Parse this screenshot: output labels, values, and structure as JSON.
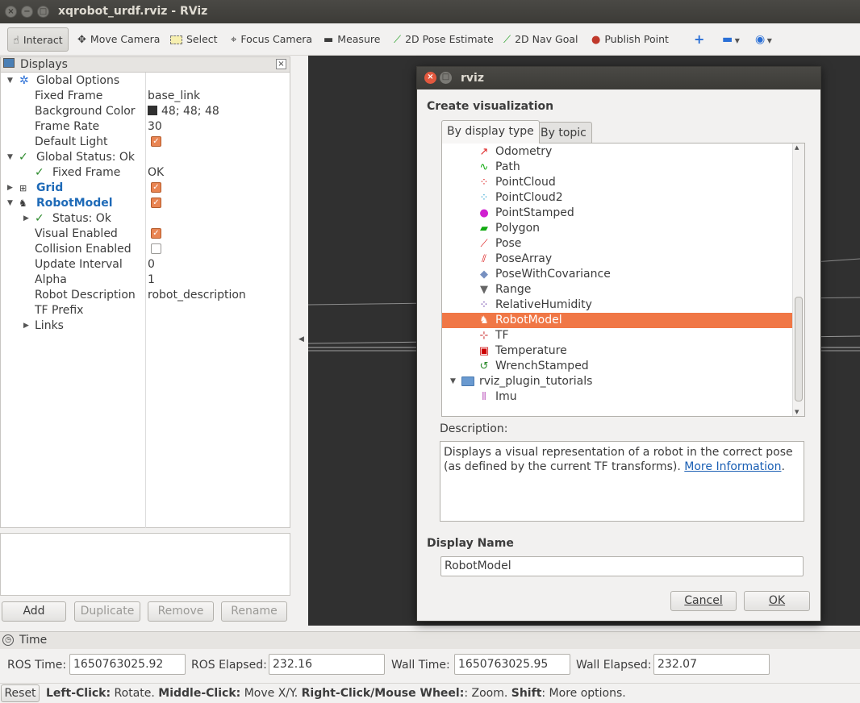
{
  "window": {
    "title": "xqrobot_urdf.rviz - RViz"
  },
  "toolbar": {
    "interact": "Interact",
    "move_camera": "Move Camera",
    "select": "Select",
    "focus_camera": "Focus Camera",
    "measure": "Measure",
    "pose_estimate": "2D Pose Estimate",
    "nav_goal": "2D Nav Goal",
    "publish_point": "Publish Point"
  },
  "displays": {
    "title": "Displays",
    "global_options": "Global Options",
    "fixed_frame_label": "Fixed Frame",
    "fixed_frame_value": "base_link",
    "bg_color_label": "Background Color",
    "bg_color_value": "48; 48; 48",
    "frame_rate_label": "Frame Rate",
    "frame_rate_value": "30",
    "default_light_label": "Default Light",
    "global_status": "Global Status: Ok",
    "gs_fixed_frame": "Fixed Frame",
    "gs_fixed_frame_value": "OK",
    "grid": "Grid",
    "robot_model": "RobotModel",
    "status_ok": "Status: Ok",
    "visual_enabled": "Visual Enabled",
    "collision_enabled": "Collision Enabled",
    "update_interval_label": "Update Interval",
    "update_interval_value": "0",
    "alpha_label": "Alpha",
    "alpha_value": "1",
    "robot_desc_label": "Robot Description",
    "robot_desc_value": "robot_description",
    "tf_prefix": "TF Prefix",
    "links": "Links"
  },
  "panel_buttons": {
    "add": "Add",
    "duplicate": "Duplicate",
    "remove": "Remove",
    "rename": "Rename"
  },
  "time": {
    "title": "Time",
    "ros_time_label": "ROS Time:",
    "ros_time": "1650763025.92",
    "ros_elapsed_label": "ROS Elapsed:",
    "ros_elapsed": "232.16",
    "wall_time_label": "Wall Time:",
    "wall_time": "1650763025.95",
    "wall_elapsed_label": "Wall Elapsed:",
    "wall_elapsed": "232.07"
  },
  "status": {
    "reset": "Reset",
    "left_click": "Left-Click:",
    "left_action": " Rotate. ",
    "middle_click": "Middle-Click:",
    "middle_action": " Move X/Y. ",
    "right_click": "Right-Click/Mouse Wheel:",
    "right_action": ": Zoom. ",
    "shift": "Shift",
    "shift_action": ": More options."
  },
  "dialog": {
    "title": "rviz",
    "heading": "Create visualization",
    "tab_display": "By display type",
    "tab_topic": "By topic",
    "items": [
      {
        "label": "Odometry",
        "icon": "odometry-icon"
      },
      {
        "label": "Path",
        "icon": "path-icon"
      },
      {
        "label": "PointCloud",
        "icon": "pointcloud-icon"
      },
      {
        "label": "PointCloud2",
        "icon": "pointcloud2-icon"
      },
      {
        "label": "PointStamped",
        "icon": "pointstamped-icon"
      },
      {
        "label": "Polygon",
        "icon": "polygon-icon"
      },
      {
        "label": "Pose",
        "icon": "pose-icon"
      },
      {
        "label": "PoseArray",
        "icon": "posearray-icon"
      },
      {
        "label": "PoseWithCovariance",
        "icon": "posewithcovariance-icon"
      },
      {
        "label": "Range",
        "icon": "range-icon"
      },
      {
        "label": "RelativeHumidity",
        "icon": "relativehumidity-icon"
      },
      {
        "label": "RobotModel",
        "icon": "robotmodel-icon"
      },
      {
        "label": "TF",
        "icon": "tf-icon"
      },
      {
        "label": "Temperature",
        "icon": "temperature-icon"
      },
      {
        "label": "WrenchStamped",
        "icon": "wrenchstamped-icon"
      }
    ],
    "folder": "rviz_plugin_tutorials",
    "folder_child": "Imu",
    "description_label": "Description:",
    "description_text": "Displays a visual representation of a robot in the correct pose (as defined by the current TF transforms).",
    "more_info": "More Information",
    "display_name_label": "Display Name",
    "display_name_value": "RobotModel",
    "cancel": "Cancel",
    "ok": "OK"
  }
}
